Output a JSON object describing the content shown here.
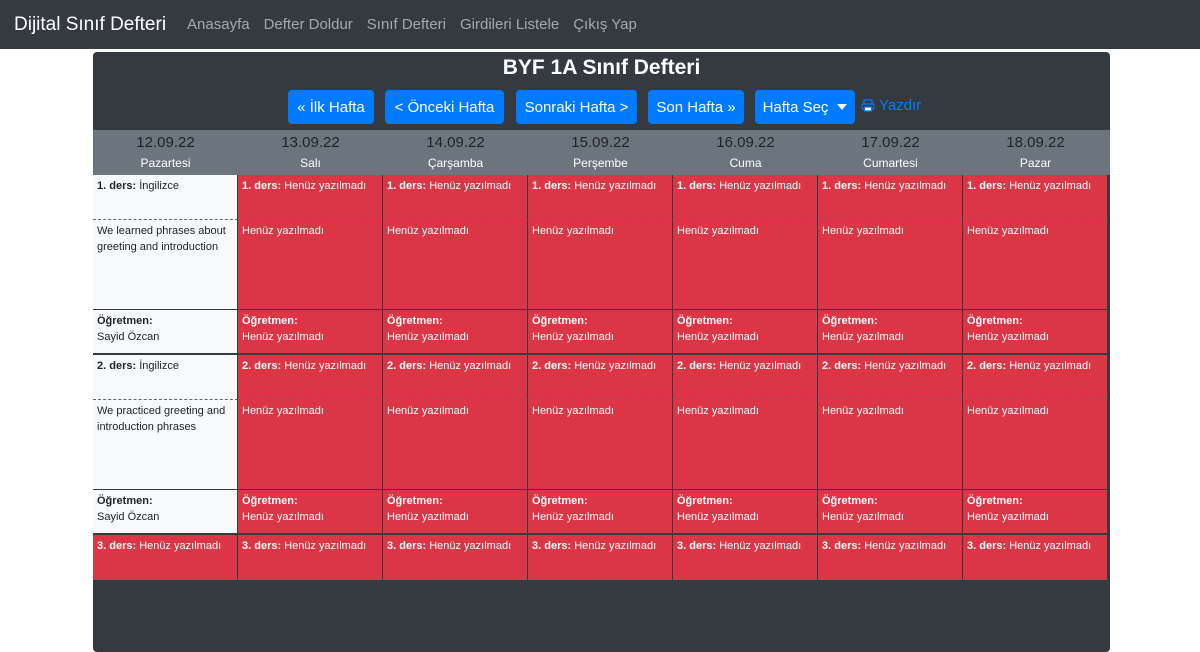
{
  "navbar": {
    "brand": "Dijital Sınıf Defteri",
    "links": [
      "Anasayfa",
      "Defter Doldur",
      "Sınıf Defteri",
      "Girdileri Listele",
      "Çıkış Yap"
    ]
  },
  "panel": {
    "title": "BYF 1A Sınıf Defteri",
    "buttons": {
      "first": "« İlk Hafta",
      "prev": "< Önceki Hafta",
      "next": "Sonraki Hafta >",
      "last": "Son Hafta »",
      "select": "Hafta Seç"
    },
    "print_label": "Yazdır"
  },
  "days": [
    {
      "date": "12.09.22",
      "name": "Pazartesi"
    },
    {
      "date": "13.09.22",
      "name": "Salı"
    },
    {
      "date": "14.09.22",
      "name": "Çarşamba"
    },
    {
      "date": "15.09.22",
      "name": "Perşembe"
    },
    {
      "date": "16.09.22",
      "name": "Cuma"
    },
    {
      "date": "17.09.22",
      "name": "Cumartesi"
    },
    {
      "date": "18.09.22",
      "name": "Pazar"
    }
  ],
  "labels": {
    "teacher": "Öğretmen:",
    "not_written": "Henüz yazılmadı"
  },
  "lessons": [
    {
      "label": "1. ders:",
      "monday": {
        "subject": "İngilizce",
        "topic": "We learned phrases about greeting and introduction",
        "teacher": "Sayid Özcan"
      }
    },
    {
      "label": "2. ders:",
      "monday": {
        "subject": "İngilizce",
        "topic": "We practiced greeting and introduction phrases",
        "teacher": "Sayid Özcan"
      }
    },
    {
      "label": "3. ders:"
    }
  ],
  "colors": {
    "navbar": "#343a40",
    "primary": "#007bff",
    "danger": "#dc3545",
    "header": "#6c757d"
  },
  "icons": {
    "print": "printer-icon",
    "dropdown": "caret-down-icon"
  }
}
